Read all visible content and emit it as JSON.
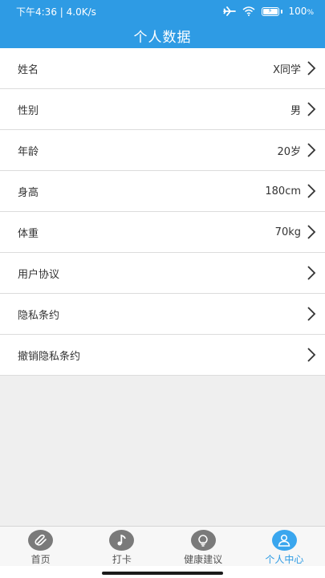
{
  "status_bar": {
    "left_text": "下午4:36 | 4.0K/s",
    "battery_text": "100",
    "battery_level": 1.0
  },
  "header": {
    "title": "个人数据"
  },
  "rows": [
    {
      "label": "姓名",
      "value": "X同学"
    },
    {
      "label": "性别",
      "value": "男"
    },
    {
      "label": "年龄",
      "value": "20岁"
    },
    {
      "label": "身高",
      "value": "180cm"
    },
    {
      "label": "体重",
      "value": "70kg"
    },
    {
      "label": "用户协议",
      "value": ""
    },
    {
      "label": "隐私条约",
      "value": ""
    },
    {
      "label": "撤销隐私条约",
      "value": ""
    }
  ],
  "tabs": [
    {
      "label": "首页",
      "icon": "paperclip-icon"
    },
    {
      "label": "打卡",
      "icon": "music-note-icon"
    },
    {
      "label": "健康建议",
      "icon": "lightbulb-icon"
    },
    {
      "label": "个人中心",
      "icon": "person-icon"
    }
  ],
  "colors": {
    "primary": "#2e9be4",
    "active_tab": "#3aa6ee",
    "inactive_icon": "#7a7a7a",
    "background": "#efefef"
  }
}
